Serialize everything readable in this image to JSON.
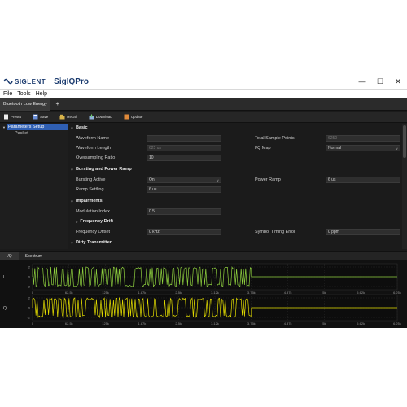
{
  "app": {
    "brand": "SIGLENT",
    "name": "SigIQPro"
  },
  "window_buttons": [
    "—",
    "☐",
    "✕"
  ],
  "menu": [
    "File",
    "Tools",
    "Help"
  ],
  "doc_tab": "Bluetooth Low Energy",
  "add_tab": "+",
  "toolbar": [
    "Preset",
    "Save",
    "Recall",
    "Download",
    "Update"
  ],
  "tree": {
    "root": "Parameters Setup",
    "child": "Packet"
  },
  "sections": {
    "basic": "Basic",
    "bursting": "Bursting and Power Ramp",
    "impairments": "Impairments",
    "freq_drift": "Frequency Drift",
    "dirty": "Dirty Transmitter"
  },
  "fields": {
    "waveform_name": {
      "label": "Waveform Name",
      "value": ""
    },
    "waveform_length": {
      "label": "Waveform Length",
      "value": "625 us"
    },
    "oversampling": {
      "label": "Oversampling Ratio",
      "value": "10"
    },
    "total_samples": {
      "label": "Total Sample Points",
      "value": "6250"
    },
    "iq_map": {
      "label": "I/Q Map",
      "value": "Normal"
    },
    "bursting_active": {
      "label": "Bursting Active",
      "value": "On"
    },
    "burst_settling": {
      "label": "Ramp Settling",
      "value": "6 us"
    },
    "power_ramp": {
      "label": "Power Ramp",
      "value": "6 us"
    },
    "mod_index": {
      "label": "Modulation Index",
      "value": "0.5"
    },
    "freq_offset": {
      "label": "Frequency Offset",
      "value": "0 kHz"
    },
    "symbol_timing": {
      "label": "Symbol Timing Error",
      "value": "0 ppm"
    }
  },
  "bottom_tabs": [
    "I/Q",
    "Spectrum"
  ],
  "plots": {
    "i_label": "I",
    "q_label": "Q",
    "x_ticks": [
      "0",
      "62.5k",
      "125k",
      "1.87k",
      "2.5k",
      "3.12k",
      "3.75k",
      "4.37k",
      "5k",
      "5.62k",
      "6.25k"
    ],
    "y_ticks": [
      "2",
      "0",
      "-2"
    ],
    "colors": {
      "i": "#8fd13f",
      "q": "#e6e000"
    },
    "active_fraction": 0.6
  }
}
